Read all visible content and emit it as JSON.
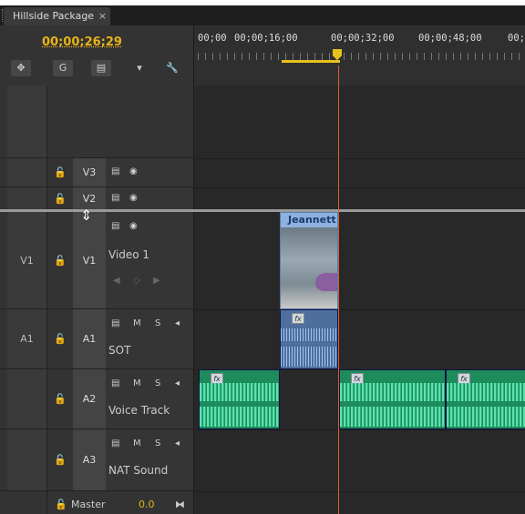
{
  "tab": {
    "title": "Hillside Package",
    "close": "×"
  },
  "header": {
    "timecode": "00;00;26;29",
    "tools": {
      "snap": "✥",
      "link": "G",
      "markers": "▤",
      "add_marker": "▾",
      "settings": "🔧"
    }
  },
  "ruler": {
    "labels": [
      "00;00",
      "00;00;16;00",
      "00;00;32;00",
      "00;00;48;00",
      "00;0"
    ]
  },
  "video_tracks": [
    {
      "id": "V3",
      "lock": "🔓"
    },
    {
      "id": "V2",
      "lock": "🔓"
    },
    {
      "id": "V1",
      "source": "V1",
      "lock": "🔓",
      "name": "Video 1"
    }
  ],
  "audio_tracks": [
    {
      "id": "A1",
      "source": "A1",
      "name": "SOT",
      "m": "M",
      "s": "S"
    },
    {
      "id": "A2",
      "name": "Voice Track",
      "m": "M",
      "s": "S"
    },
    {
      "id": "A3",
      "name": "NAT Sound",
      "m": "M",
      "s": "S"
    }
  ],
  "master": {
    "label": "Master",
    "value": "0.0"
  },
  "clips": {
    "video1_title": "Jeannett",
    "fx_label": "fx"
  }
}
